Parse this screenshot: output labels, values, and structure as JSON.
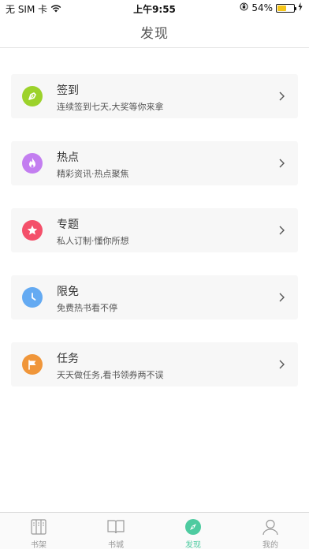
{
  "status_bar": {
    "carrier": "无 SIM 卡",
    "time": "上午9:55",
    "battery_percent": "54%",
    "battery_level": 0.54,
    "wifi_icon": "wifi-icon",
    "lock_icon": "orientation-lock-icon",
    "charging_icon": "charging-icon"
  },
  "nav": {
    "title": "发现"
  },
  "cards": [
    {
      "title": "签到",
      "subtitle": "连续签到七天,大奖等你来拿",
      "icon": "pen-icon",
      "color": "#9cd22b"
    },
    {
      "title": "热点",
      "subtitle": "精彩资讯·热点聚焦",
      "icon": "flame-icon",
      "color": "#c37ef0"
    },
    {
      "title": "专题",
      "subtitle": "私人订制·懂你所想",
      "icon": "star-icon",
      "color": "#f4506a"
    },
    {
      "title": "限免",
      "subtitle": "免费热书看不停",
      "icon": "clock-icon",
      "color": "#64aaf2"
    },
    {
      "title": "任务",
      "subtitle": "天天做任务,看书领券两不误",
      "icon": "flag-icon",
      "color": "#f0963a"
    }
  ],
  "tabs": [
    {
      "label": "书架",
      "icon": "bookshelf-icon",
      "active": false
    },
    {
      "label": "书城",
      "icon": "book-icon",
      "active": false
    },
    {
      "label": "发现",
      "icon": "compass-icon",
      "active": true
    },
    {
      "label": "我的",
      "icon": "person-icon",
      "active": false
    }
  ],
  "colors": {
    "accent": "#4ecba0",
    "battery": "#f5c518",
    "inactive_tab": "#999999"
  }
}
